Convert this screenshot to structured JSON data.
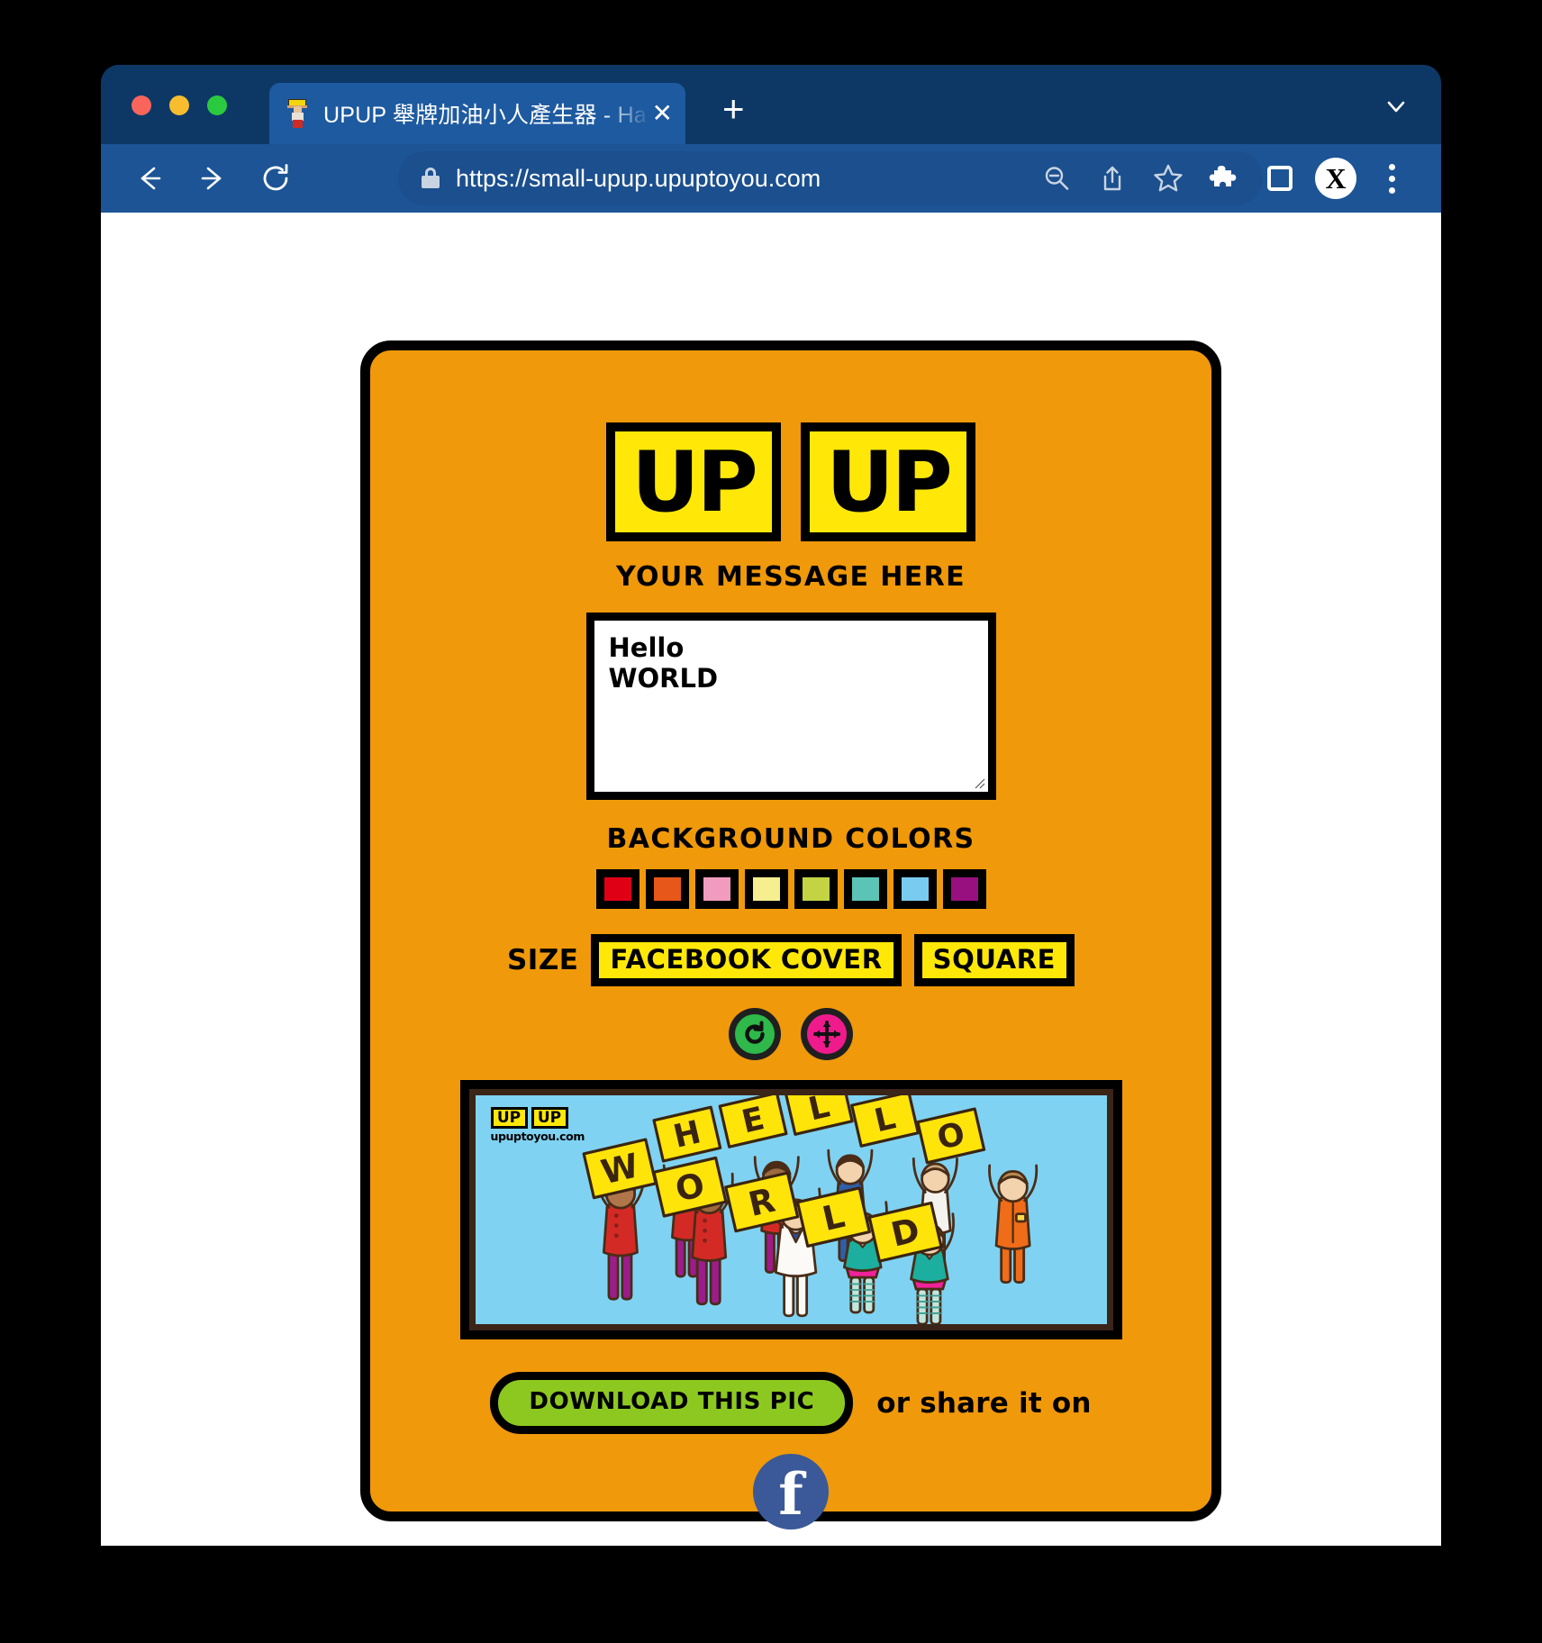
{
  "browser": {
    "tab": {
      "title": "UPUP 舉牌加油小人產生器 - Ha",
      "favicon_name": "upup-person-favicon",
      "close_label": "✕"
    },
    "new_tab_label": "+",
    "url": "https://small-upup.upuptoyou.com",
    "toolbar_icons": [
      "back-icon",
      "forward-icon",
      "reload-icon",
      "zoom-out-icon",
      "share-icon",
      "bookmark-star-icon",
      "extensions-puzzle-icon",
      "sidebar-panel-icon",
      "profile-avatar",
      "more-menu-icon"
    ],
    "avatar_letter": "X"
  },
  "app": {
    "logo": {
      "left": "UP",
      "right": "UP"
    },
    "message_label": "YOUR MESSAGE HERE",
    "message_value": "Hello\nWORLD",
    "message_placeholder": "",
    "background_colors_label": "BACKGROUND COLORS",
    "swatches": [
      {
        "name": "red",
        "hex": "#e00016"
      },
      {
        "name": "orange",
        "hex": "#e8571a"
      },
      {
        "name": "pink",
        "hex": "#f19bbf"
      },
      {
        "name": "pale-yellow",
        "hex": "#f5ef8f"
      },
      {
        "name": "yellow-green",
        "hex": "#c4d344"
      },
      {
        "name": "teal",
        "hex": "#5bc4b6"
      },
      {
        "name": "light-blue",
        "hex": "#79ccf0"
      },
      {
        "name": "purple",
        "hex": "#98107f"
      }
    ],
    "size_label": "SIZE",
    "size_options": [
      "FACEBOOK COVER",
      "SQUARE"
    ],
    "size_selected": "FACEBOOK COVER",
    "action_buttons": [
      {
        "name": "refresh-button",
        "icon": "refresh-icon",
        "color": "#2eb94a"
      },
      {
        "name": "move-button",
        "icon": "move-arrows-icon",
        "color": "#ef1b8c"
      }
    ],
    "preview": {
      "background_hex": "#7fd2f2",
      "watermark_boxes": [
        "UP",
        "UP"
      ],
      "watermark_url": "upuptoyou.com",
      "sign_row_1": "HELLO",
      "sign_row_2": "WORLD"
    },
    "download_label": "DOWNLOAD THIS PIC",
    "share_text": "or share it on",
    "facebook_label": "f"
  },
  "colors": {
    "card_bg": "#f0990a",
    "accent_yellow": "#ffe808",
    "download_green": "#8dc820",
    "browser_chrome": "#1c5496",
    "tabstrip": "#0d3866"
  }
}
